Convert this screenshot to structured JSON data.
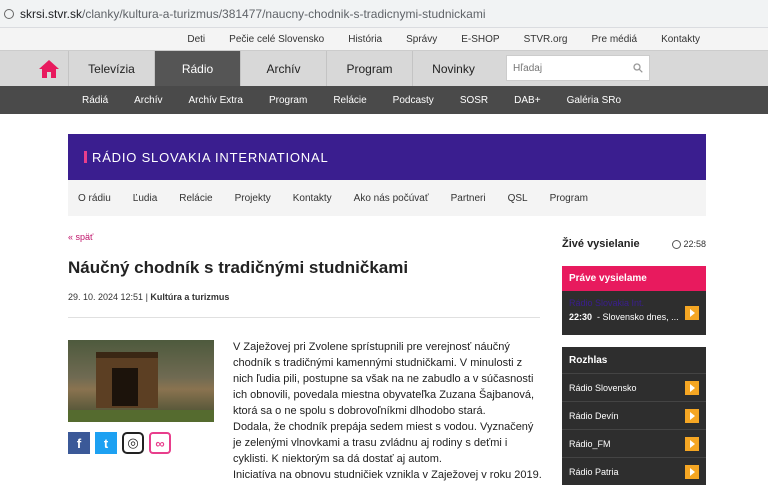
{
  "browser": {
    "url_host": "skrsi.stvr.sk",
    "url_path": "/clanky/kultura-a-turizmus/381477/naucny-chodnik-s-tradicnymi-studnickami"
  },
  "topnav": [
    "Deti",
    "Pečie celé Slovensko",
    "História",
    "Správy",
    "E-SHOP",
    "STVR.org",
    "Pre médiá",
    "Kontakty"
  ],
  "mainnav": {
    "tabs": [
      "Televízia",
      "Rádio",
      "Archív",
      "Program",
      "Novinky"
    ],
    "active": "Rádio",
    "search_placeholder": "Hľadaj"
  },
  "subnav": [
    "Rádiá",
    "Archív",
    "Archív Extra",
    "Program",
    "Relácie",
    "Podcasty",
    "SOSR",
    "DAB+",
    "Galéria SRo"
  ],
  "banner": {
    "title": "RÁDIO SLOVAKIA INTERNATIONAL"
  },
  "rsinav": [
    "O rádiu",
    "Ľudia",
    "Relácie",
    "Projekty",
    "Kontakty",
    "Ako nás počúvať",
    "Partneri",
    "QSL",
    "Program"
  ],
  "article": {
    "back": "« späť",
    "title": "Náučný chodník s tradičnými studničkami",
    "date": "29. 10. 2024 12:51",
    "separator": " | ",
    "category": "Kultúra a turizmus",
    "paragraphs": [
      "V Zaježovej pri Zvolene sprístupnili pre verejnosť náučný chodník s tradičnými kamennými studničkami. V minulosti z nich ľudia pili, postupne sa však na ne zabudlo a v súčasnosti ich obnovili, povedala miestna obyvateľka Zuzana Šajbanová, ktorá sa o ne spolu s dobrovoľníkmi dlhodobo stará.",
      "Dodala, že chodník prepája sedem miest s vodou. Vyznačený je zelenými vlnovkami a trasu zvládnu aj rodiny s deťmi i cyklisti. K niektorým sa dá dostať aj autom.",
      "Iniciatíva na obnovu studničiek vznikla v Zaježovej v roku 2019."
    ]
  },
  "sidebar": {
    "live_label": "Živé vysielanie",
    "live_time": "22:58",
    "now_label": "Práve vysielame",
    "now_channel": "Rádio",
    "now_channel_name": "Slovakia Int.",
    "now_time": "22:30",
    "now_show": "- Slovensko dnes, ...",
    "rozhlas_label": "Rozhlas",
    "stations": [
      "Rádio Slovensko",
      "Rádio Devín",
      "Rádio_FM",
      "Rádio Patria"
    ]
  },
  "colors": {
    "brand_purple": "#3a1e8f",
    "accent_pink": "#e81a5e",
    "play_orange": "#f5a623"
  }
}
